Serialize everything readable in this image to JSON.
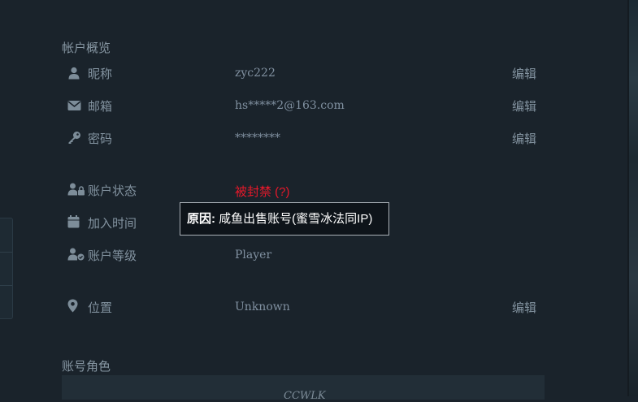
{
  "overview": {
    "title": "帐户概览",
    "rows": [
      {
        "label": "昵称",
        "value": "zyc222",
        "edit": "编辑",
        "icon": "user-icon"
      },
      {
        "label": "邮箱",
        "value": "hs*****2@163.com",
        "edit": "编辑",
        "icon": "envelope-icon"
      },
      {
        "label": "密码",
        "value": "********",
        "edit": "编辑",
        "icon": "key-icon"
      }
    ]
  },
  "status": {
    "rows": [
      {
        "label": "账户状态",
        "value": "被封禁 (?)",
        "icon": "user-lock-icon"
      },
      {
        "label": "加入时间",
        "value": "",
        "icon": "calendar-icon"
      },
      {
        "label": "账户等级",
        "value": "Player",
        "icon": "user-badge-icon"
      }
    ]
  },
  "location": {
    "label": "位置",
    "value": "Unknown",
    "edit": "编辑",
    "icon": "map-marker-icon"
  },
  "tooltip": {
    "prefix": "原因:",
    "text": "咸鱼出售账号(蜜雪冰法同IP)"
  },
  "roles": {
    "title": "账号角色",
    "card_text": "CCWLK"
  },
  "colors": {
    "banned": "#e8182a",
    "background": "#1a232b"
  }
}
